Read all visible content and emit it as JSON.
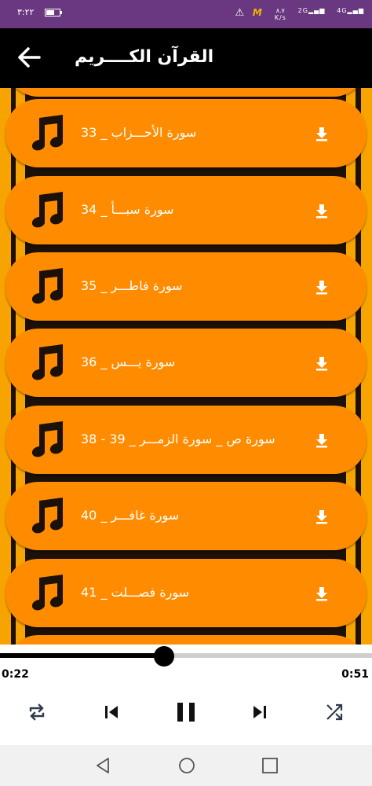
{
  "status_bar": {
    "time": "٣:٢٢",
    "net_speed_value": "٨.٧",
    "net_speed_unit": "K/s",
    "sim1": "2G",
    "sim2": "4G",
    "warning": "⚠"
  },
  "app_bar": {
    "title": "القرآن الكــــريم",
    "back_icon": "arrow-back-icon"
  },
  "list": {
    "items": [
      {
        "label": "سورة الأحـــزاب  _  33",
        "icon": "music-note-icon",
        "action_icon": "download-icon"
      },
      {
        "label": "سورة سبـــأ  _  34",
        "icon": "music-note-icon",
        "action_icon": "download-icon"
      },
      {
        "label": "سورة فاطـــر  _  35",
        "icon": "music-note-icon",
        "action_icon": "download-icon"
      },
      {
        "label": "سورة يـــس  _  36",
        "icon": "music-note-icon",
        "action_icon": "download-icon"
      },
      {
        "label": "سورة ص _ سورة الزمـــر  _  39 - 38",
        "icon": "music-note-icon",
        "action_icon": "download-icon"
      },
      {
        "label": "سورة غافـــر  _  40",
        "icon": "music-note-icon",
        "action_icon": "download-icon"
      },
      {
        "label": "سورة فصـــلت  _  41",
        "icon": "music-note-icon",
        "action_icon": "download-icon"
      }
    ]
  },
  "player": {
    "current_time": "0:22",
    "duration": "0:51",
    "progress": 0.44,
    "controls": [
      "repeat-icon",
      "skip-previous-icon",
      "pause-icon",
      "skip-next-icon",
      "shuffle-icon"
    ]
  },
  "nav_bar": {
    "buttons": [
      "back-triangle-icon",
      "home-circle-icon",
      "recents-square-icon"
    ]
  },
  "colors": {
    "status_bar": "#6a3880",
    "app_bar": "#000000",
    "item_bg": "#ff8c00",
    "stripe": "#f7a400",
    "text": "#ffffff"
  }
}
